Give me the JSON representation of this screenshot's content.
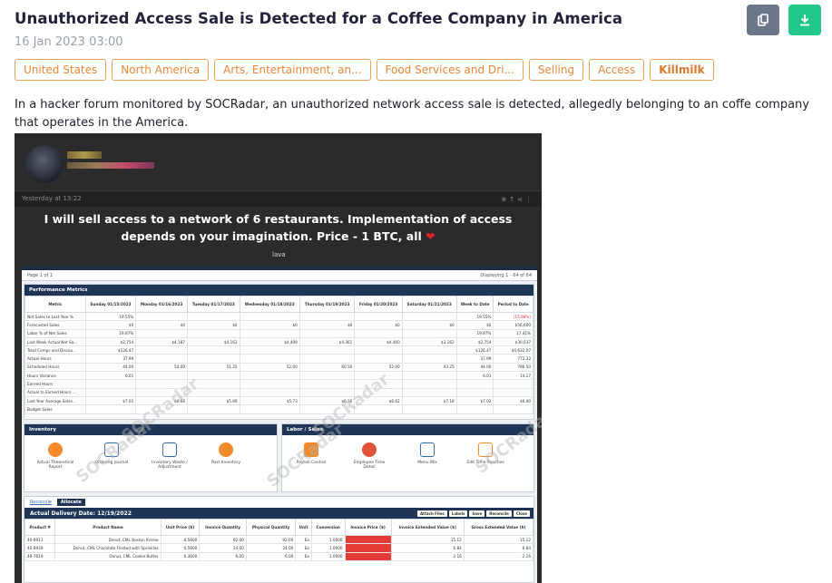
{
  "article": {
    "title": "Unauthorized Access Sale is Detected for a Coffee Company in America",
    "date": "16 Jan 2023 03:00",
    "description": "In a hacker forum monitored by SOCRadar, an unauthorized network access sale is detected, allegedly belonging to an coffe company that operates in the America."
  },
  "actions": {
    "copy_icon": "copy-icon",
    "download_icon": "download-icon",
    "colors": {
      "copy": "#6c7789",
      "download": "#22c88a",
      "tag": "#e8a25a"
    }
  },
  "tags": [
    {
      "label": "United States"
    },
    {
      "label": "North America"
    },
    {
      "label": "Arts, Entertainment, an..."
    },
    {
      "label": "Food Services and Dri..."
    },
    {
      "label": "Selling"
    },
    {
      "label": "Access"
    },
    {
      "label": "Killmilk"
    }
  ],
  "screenshot": {
    "post_time": "Yesterday at 13:22",
    "banner": "I will sell access to a network of 6 restaurants. Implementation of access depends on your imagination. Price - 1 BTC, all",
    "signature": "lava",
    "pager": {
      "page_label": "Page",
      "page": "1",
      "of": "of 1",
      "displaying": "Displaying 1 - 64 of 64"
    },
    "performance": {
      "title": "Performance Metrics",
      "columns": [
        "Metric",
        "Sunday 01/15/2023",
        "Monday 01/16/2023",
        "Tuesday 01/17/2023",
        "Wednesday 01/18/2023",
        "Thursday 01/19/2023",
        "Friday 01/20/2023",
        "Saturday 01/21/2023",
        "Week to Date",
        "Period to Date"
      ],
      "rows": [
        [
          "Net Sales to Last Year %",
          "19.55%",
          "",
          "",
          "",
          "",
          "",
          "",
          "19.55%",
          "(15.98%)"
        ],
        [
          "Forecasted Sales",
          "$0",
          "$0",
          "$0",
          "$0",
          "$0",
          "$0",
          "$0",
          "$0",
          "$56,600"
        ],
        [
          "Labor % of Net Sales",
          "19.87%",
          "",
          "",
          "",
          "",
          "",
          "",
          "19.87%",
          "17.41%"
        ],
        [
          "Last Week Actual Net Sa...",
          "$2,754",
          "$4,187",
          "$4,162",
          "$4,409",
          "$4,361",
          "$4,460",
          "$3,162",
          "$2,754",
          "$30,037"
        ],
        [
          "Total Comps and Discou...",
          "$126.47",
          "",
          "",
          "",
          "",
          "",
          "",
          "$126.47",
          "$4,632.07"
        ],
        [
          "Actual Hours",
          "37.99",
          "",
          "",
          "",
          "",
          "",
          "",
          "37.99",
          "772.33"
        ],
        [
          "Scheduled Hours",
          "44.00",
          "54.00",
          "51.25",
          "52.00",
          "60.50",
          "52.00",
          "43.25",
          "44.00",
          "786.50"
        ],
        [
          "Hours Variance",
          "6.01",
          "",
          "",
          "",
          "",
          "",
          "",
          "6.01",
          "14.17"
        ],
        [
          "Earned Hours",
          "",
          "",
          "",
          "",
          "",
          "",
          "",
          "",
          ""
        ],
        [
          "Actual to Earned Hours ...",
          "",
          "",
          "",
          "",
          "",
          "",
          "",
          "",
          ""
        ],
        [
          "Last Year Average Sales...",
          "$7.02",
          "$6.66",
          "$5.69",
          "$5.73",
          "$6.16",
          "$6.62",
          "$7.18",
          "$7.02",
          "$6.40"
        ],
        [
          "Budget Sales",
          "",
          "",
          "",
          "",
          "",
          "",
          "",
          "",
          ""
        ]
      ]
    },
    "inventory": {
      "title": "Inventory",
      "tiles": [
        "Actual Theoretical Report",
        "Ordering Journal",
        "Inventory Waste / Adjustment",
        "Post Inventory"
      ]
    },
    "labor": {
      "title": "Labor / Sales",
      "tiles": [
        "Payroll Control",
        "Employee Time Detail",
        "Menu Mix",
        "Edit Time Punches"
      ]
    },
    "reconcile": {
      "tabs": [
        "Reconcile",
        "Allocate"
      ],
      "bar_title": "Actual Delivery Date: 12/19/2022",
      "buttons": [
        "Attach Files",
        "Labels",
        "Save",
        "Reconcile",
        "Close"
      ],
      "columns": [
        "Product #",
        "Product Name",
        "Unit Price ($)",
        "Invoice Quantity",
        "Physical Quantity",
        "Unit",
        "Conversion",
        "Invoice Price ($)",
        "Invoice Extended Value ($)",
        "Gross Extended Value ($)"
      ],
      "rows": [
        [
          "40-8911",
          "Donut, CML Boston Kreme",
          "0.5600",
          "92.00",
          "92.00",
          "Ea",
          "1.0000",
          "",
          "15.12",
          "15.12"
        ],
        [
          "40-8939",
          "Donut, CML Chocolate Frosted with Sprinkles",
          "0.5600",
          "24.00",
          "24.00",
          "Ea",
          "1.0000",
          "",
          "6.84",
          "6.84"
        ],
        [
          "40-7619",
          "Donut, CML Cookie Butter",
          "0.3600",
          "6.00",
          "6.00",
          "Ea",
          "1.0000",
          "",
          "2.16",
          "2.16"
        ]
      ]
    },
    "watermark": "SOCRadar"
  }
}
